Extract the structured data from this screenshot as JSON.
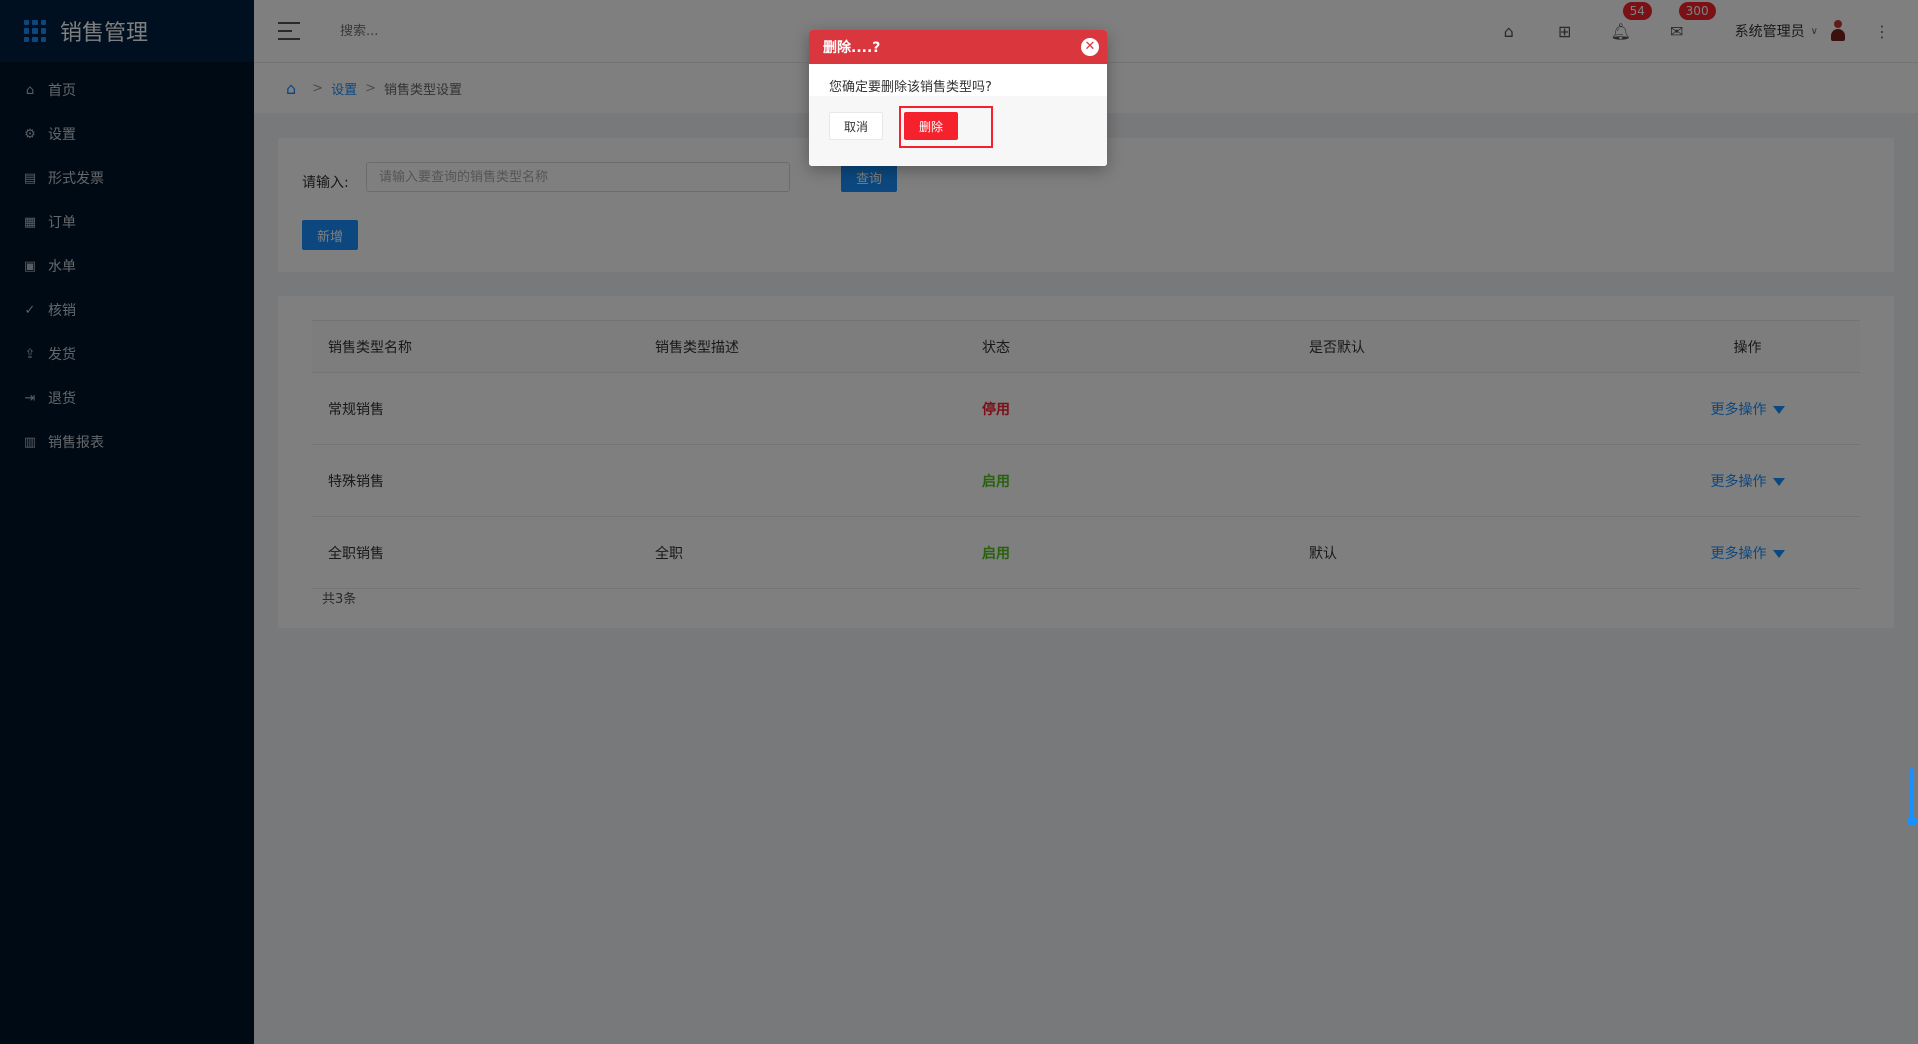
{
  "app": {
    "title": "销售管理"
  },
  "sidebar": {
    "items": [
      {
        "label": "首页",
        "icon": "home-icon"
      },
      {
        "label": "设置",
        "icon": "gear-icon"
      },
      {
        "label": "形式发票",
        "icon": "invoice-icon"
      },
      {
        "label": "订单",
        "icon": "order-icon"
      },
      {
        "label": "水单",
        "icon": "receipt-icon"
      },
      {
        "label": "核销",
        "icon": "check-circle-icon"
      },
      {
        "label": "发货",
        "icon": "upload-icon"
      },
      {
        "label": "退货",
        "icon": "logout-icon"
      },
      {
        "label": "销售报表",
        "icon": "bar-chart-icon"
      }
    ]
  },
  "header": {
    "search_placeholder": "搜索...",
    "notifications_count": "54",
    "messages_count": "300",
    "user_name": "系统管理员"
  },
  "breadcrumb": {
    "level1": "设置",
    "level2": "销售类型设置"
  },
  "filter": {
    "label": "请输入:",
    "placeholder": "请输入要查询的销售类型名称",
    "query_label": "查询",
    "add_label": "新增"
  },
  "table": {
    "headers": [
      "销售类型名称",
      "销售类型描述",
      "状态",
      "是否默认",
      "操作"
    ],
    "rows": [
      {
        "name": "常规销售",
        "desc": "",
        "status": "停用",
        "status_color": "#f5222d",
        "default": "",
        "op": "更多操作"
      },
      {
        "name": "特殊销售",
        "desc": "",
        "status": "启用",
        "status_color": "#52c41a",
        "default": "",
        "op": "更多操作"
      },
      {
        "name": "全职销售",
        "desc": "全职",
        "status": "启用",
        "status_color": "#52c41a",
        "default": "默认",
        "op": "更多操作"
      }
    ],
    "total": "共3条"
  },
  "modal": {
    "title": "删除....?",
    "message": "您确定要删除该销售类型吗?",
    "cancel_label": "取消",
    "delete_label": "删除"
  }
}
